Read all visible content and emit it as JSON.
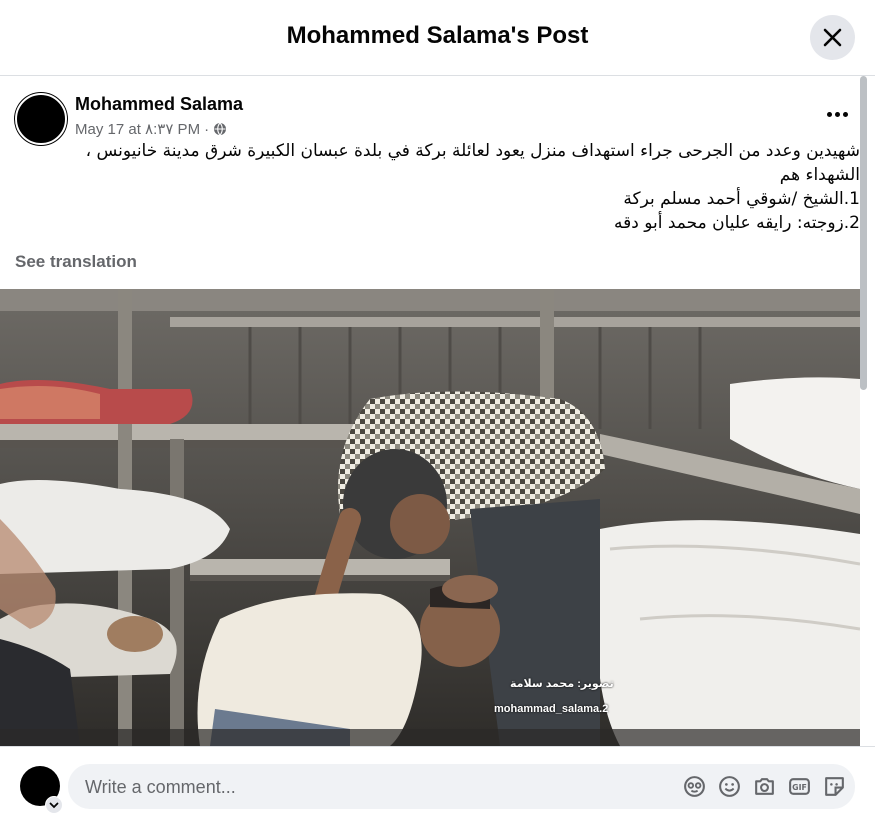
{
  "header": {
    "title": "Mohammed Salama's Post"
  },
  "post": {
    "author": "Mohammed Salama",
    "timestamp": "May 17 at ٨:٣٧ PM",
    "separator": "·",
    "privacy_icon": "globe-icon",
    "text_lines": [
      "شهيدين وعدد من الجرحى جراء استهداف منزل يعود لعائلة بركة في بلدة عبسان الكبيرة شرق مدينة خانيونس ،",
      "الشهداء هم",
      "1.الشيخ /شوقي أحمد مسلم بركة",
      "2.زوجته: رايقه عليان محمد أبو دقه"
    ],
    "see_translation": "See translation",
    "photo_watermark_arabic": "تصوير: محمد سلامة",
    "photo_watermark_handle": "mohammad_salama.2"
  },
  "comment": {
    "placeholder": "Write a comment...",
    "icons": [
      "avatar-sticker-icon",
      "emoji-icon",
      "camera-icon",
      "gif-icon",
      "sticker-icon"
    ]
  },
  "colors": {
    "secondary_text": "#65676b",
    "input_bg": "#f0f2f5",
    "button_bg": "#e4e6eb"
  }
}
